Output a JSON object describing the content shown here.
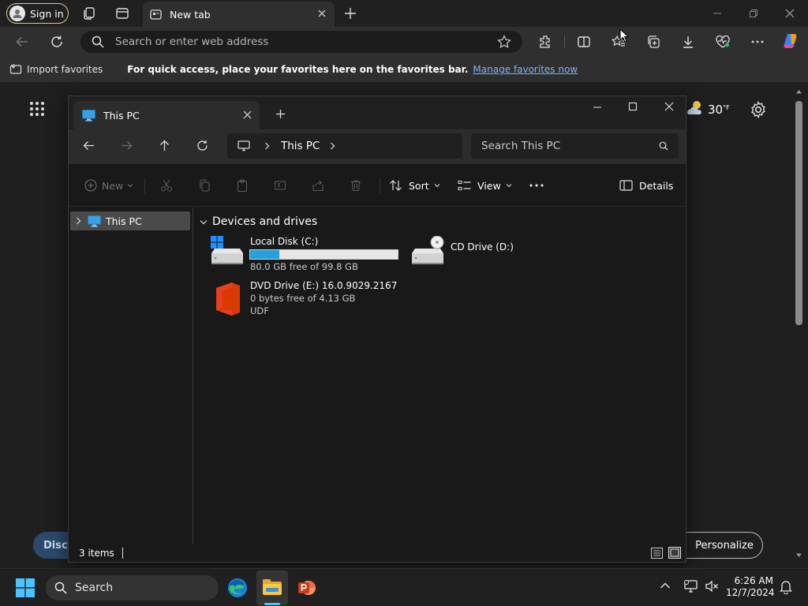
{
  "browser": {
    "signin_label": "Sign in",
    "tab_title": "New tab",
    "address_placeholder": "Search or enter web address",
    "favbar": {
      "import_label": "Import favorites",
      "hint": "For quick access, place your favorites here on the favorites bar.",
      "manage_link": "Manage favorites now"
    }
  },
  "newtab": {
    "weather_temp": "30",
    "weather_unit": "°F",
    "discover_label": "Disco",
    "personalize_label": "Personalize"
  },
  "explorer": {
    "tab_title": "This PC",
    "breadcrumb": [
      "This PC"
    ],
    "search_placeholder": "Search This PC",
    "commands": {
      "new": "New",
      "sort": "Sort",
      "view": "View",
      "details": "Details"
    },
    "sidebar": {
      "items": [
        {
          "label": "This PC"
        }
      ]
    },
    "section_title": "Devices and drives",
    "drives": [
      {
        "name": "Local Disk (C:)",
        "free": "80.0 GB free of 99.8 GB",
        "used_fraction": 0.2,
        "icon": "windows-drive-icon"
      },
      {
        "name": "CD Drive (D:)",
        "icon": "cd-drive-icon"
      },
      {
        "name": "DVD Drive (E:) 16.0.9029.2167",
        "free": "0 bytes free of 4.13 GB",
        "fs": "UDF",
        "icon": "office-icon"
      }
    ],
    "status": "3 items"
  },
  "taskbar": {
    "search_label": "Search",
    "time": "6:26 AM",
    "date": "12/7/2024"
  },
  "colors": {
    "accent": "#26a0da",
    "link": "#7fb3f5",
    "office": "#d83b01"
  }
}
